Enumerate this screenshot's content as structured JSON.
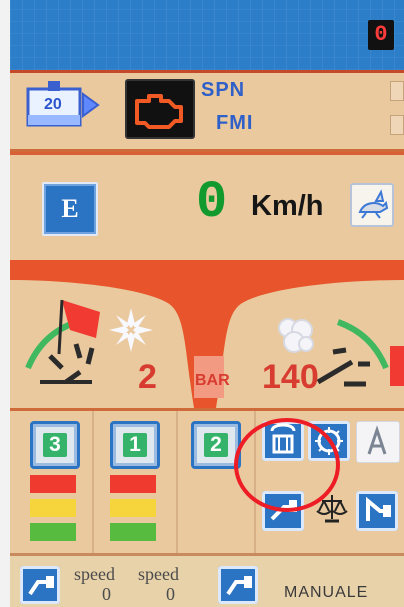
{
  "top_counter": "0",
  "diagnostics": {
    "spn_label": "SPN",
    "fmi_label": "FMI",
    "coolant_value": "20"
  },
  "speed": {
    "mode_label": "E",
    "value": "0",
    "unit": "Km/h"
  },
  "gauges": {
    "pressure_value": "2",
    "pressure_unit": "BAR",
    "temperature_value": "140"
  },
  "gears": [
    {
      "label": "3"
    },
    {
      "label": "1"
    },
    {
      "label": "2"
    }
  ],
  "speed_buttons": {
    "label_left": "speed",
    "value_left": "0",
    "label_right": "speed",
    "value_right": "0"
  },
  "mode_label": "MANUALE",
  "highlight": {
    "color": "#ee1c24",
    "target": "transmission-icon"
  },
  "colors": {
    "panel": "#e9c99d",
    "accent_orange": "#e8542b",
    "topbar_blue": "#2d7ec9",
    "button_blue": "#2b73c3"
  }
}
